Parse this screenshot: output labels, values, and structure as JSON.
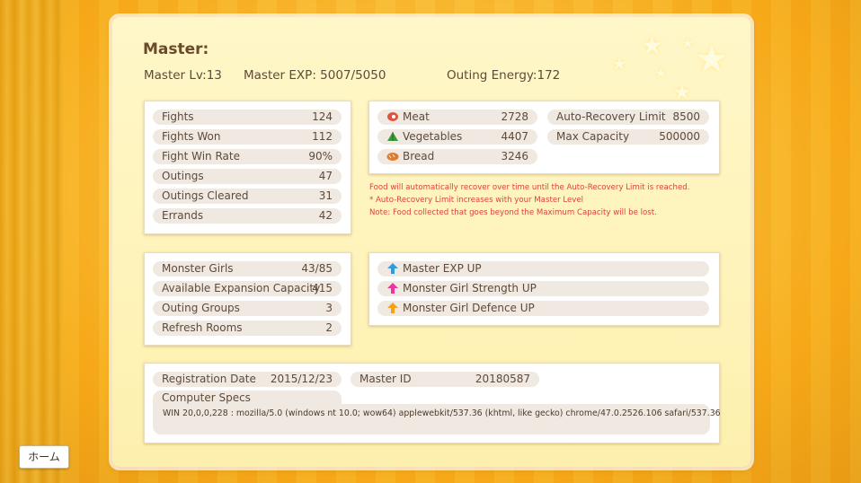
{
  "master": {
    "title": "Master:",
    "level_label": "Master Lv:",
    "level_value": "13",
    "exp_label": "Master EXP:",
    "exp_value": "5007/5050",
    "energy_label": "Outing Energy:",
    "energy_value": "172"
  },
  "fight_stats": [
    {
      "label": "Fights",
      "value": "124"
    },
    {
      "label": "Fights Won",
      "value": "112"
    },
    {
      "label": "Fight Win Rate",
      "value": "90%"
    },
    {
      "label": "Outings",
      "value": "47"
    },
    {
      "label": "Outings Cleared",
      "value": "31"
    },
    {
      "label": "Errands",
      "value": "42"
    }
  ],
  "food": {
    "items": [
      {
        "label": "Meat",
        "value": "2728",
        "icon": "meat-icon"
      },
      {
        "label": "Vegetables",
        "value": "4407",
        "icon": "vegetables-icon"
      },
      {
        "label": "Bread",
        "value": "3246",
        "icon": "bread-icon"
      }
    ],
    "limits": [
      {
        "label": "Auto-Recovery Limit",
        "value": "8500"
      },
      {
        "label": "Max Capacity",
        "value": "500000"
      }
    ],
    "notes": [
      "Food will automatically recover over time until the Auto-Recovery Limit is reached.",
      "* Auto-Recovery Limit increases with your Master Level",
      "Note: Food collected that goes beyond the Maximum Capacity will be lost."
    ]
  },
  "girls_stats": [
    {
      "label": "Monster Girls",
      "value": "43/85"
    },
    {
      "label": "Available Expansion Capacity",
      "value": "415"
    },
    {
      "label": "Outing Groups",
      "value": "3"
    },
    {
      "label": "Refresh Rooms",
      "value": "2"
    }
  ],
  "boosts": [
    {
      "label": "Master EXP UP",
      "icon": "blue-up-arrow-icon",
      "color": "#2f9be0"
    },
    {
      "label": "Monster Girl Strength UP",
      "icon": "pink-up-arrow-icon",
      "color": "#f0339a"
    },
    {
      "label": "Monster Girl Defence UP",
      "icon": "orange-up-arrow-icon",
      "color": "#f5a117"
    }
  ],
  "account": {
    "reg_label": "Registration Date",
    "reg_value": "2015/12/23",
    "id_label": "Master ID",
    "id_value": "20180587",
    "specs_label": "Computer Specs",
    "specs_value": "WIN 20,0,0,228 : mozilla/5.0 (windows nt 10.0; wow64) applewebkit/537.36 (khtml, like gecko) chrome/47.0.2526.106 safari/537.36"
  },
  "home_button": "ホーム",
  "colors": {
    "accent_text": "#6b4a2b",
    "note_red": "#d9443a",
    "background": "#f9b21a"
  }
}
